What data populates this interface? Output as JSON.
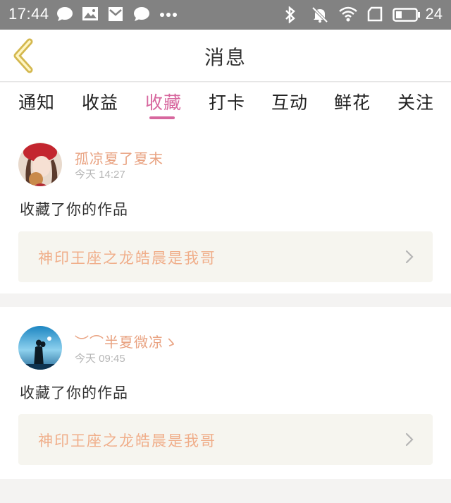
{
  "status_bar": {
    "time": "17:44",
    "battery_level": "24",
    "icons": [
      "chat-bubble-icon",
      "image-icon",
      "mail-icon",
      "chat-bubble-icon",
      "more-dots-icon",
      "bluetooth-icon",
      "mute-icon",
      "wifi-icon",
      "sim-icon",
      "battery-icon"
    ]
  },
  "header": {
    "title": "消息",
    "back_icon": "back-chevron-icon"
  },
  "tabs": [
    {
      "label": "通知",
      "active": false
    },
    {
      "label": "收益",
      "active": false
    },
    {
      "label": "收藏",
      "active": true
    },
    {
      "label": "打卡",
      "active": false
    },
    {
      "label": "互动",
      "active": false
    },
    {
      "label": "鲜花",
      "active": false
    },
    {
      "label": "关注",
      "active": false
    }
  ],
  "colors": {
    "accent": "#d7679e",
    "username": "#e9a382",
    "work_title": "#f0ae8a",
    "status_bar": "#828282"
  },
  "messages": [
    {
      "username": "孤凉夏了夏末",
      "time": "今天  14:27",
      "action": "收藏了你的作品",
      "work_title": "神印王座之龙皓晨是我哥"
    },
    {
      "username": "︶⌒半夏微凉ゝ",
      "time": "今天  09:45",
      "action": "收藏了你的作品",
      "work_title": "神印王座之龙皓晨是我哥"
    }
  ]
}
